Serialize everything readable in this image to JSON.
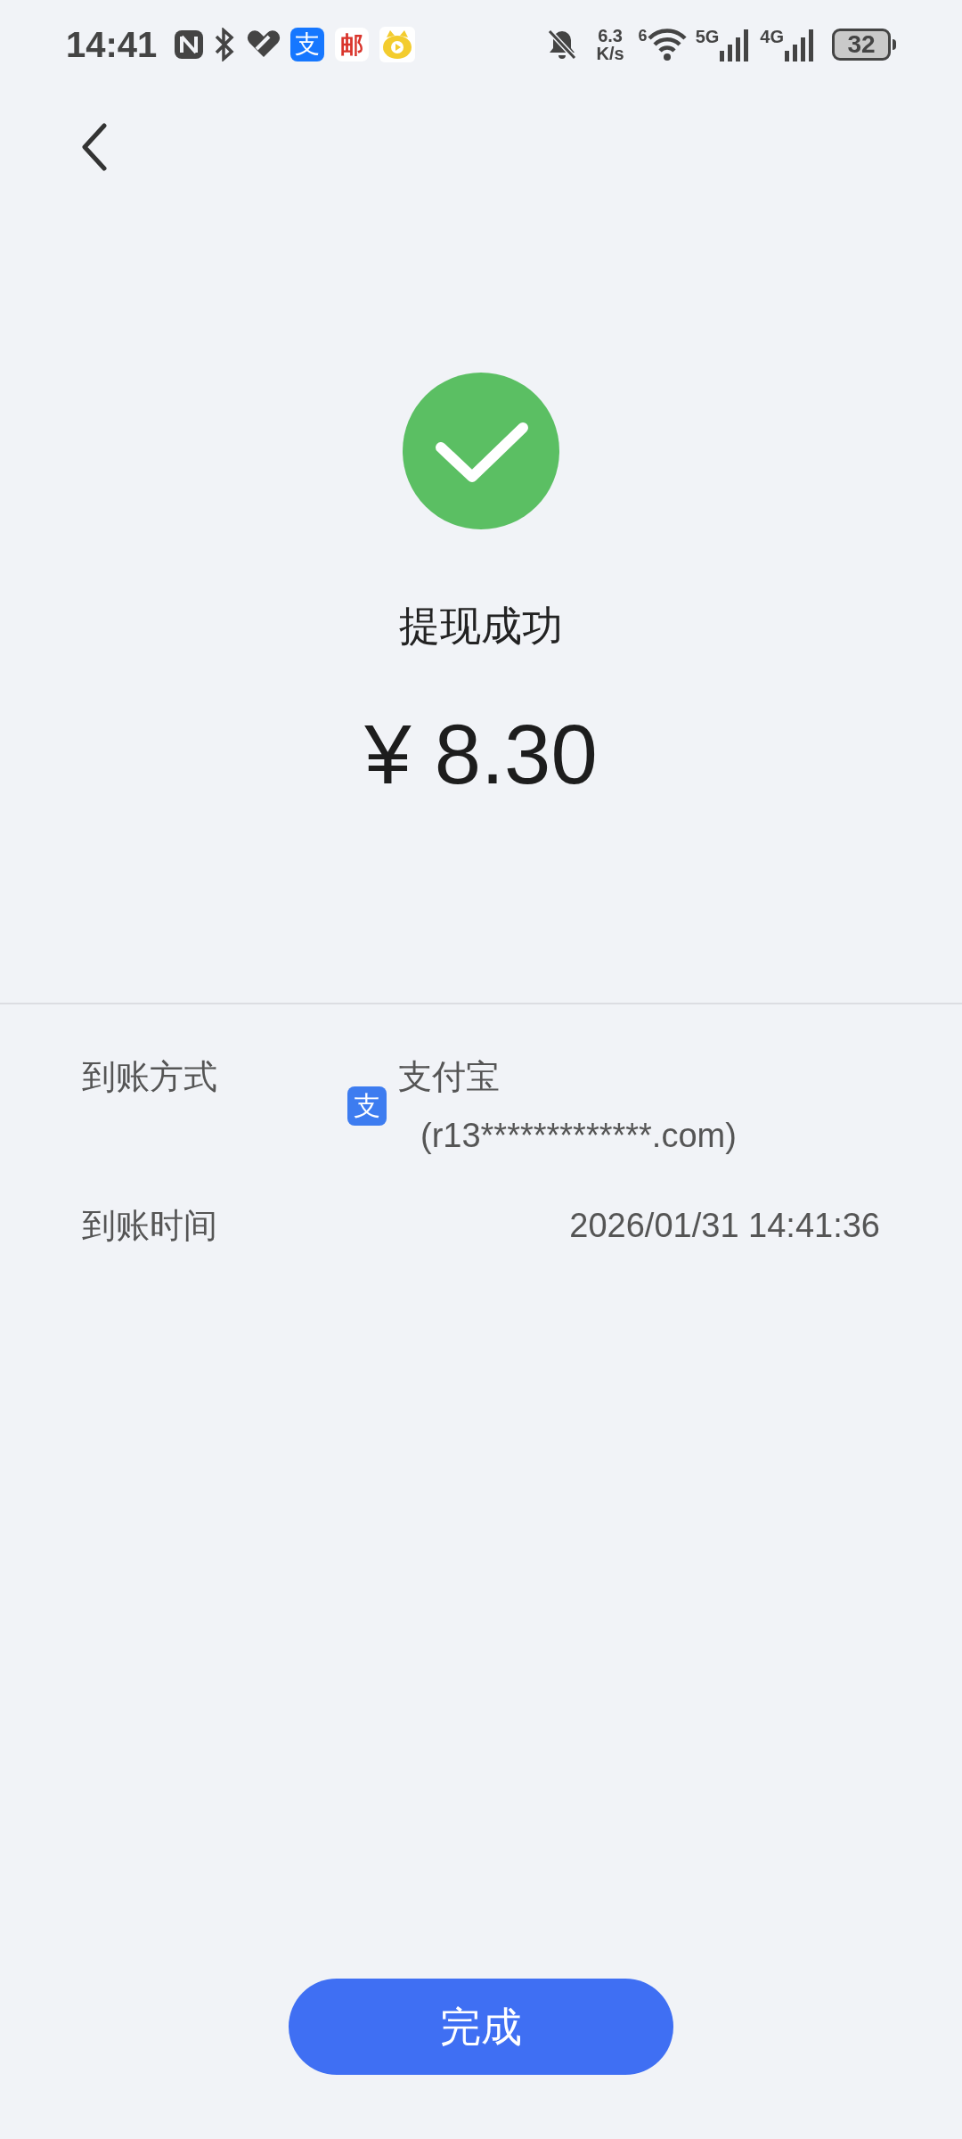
{
  "status_bar": {
    "time": "14:41",
    "app_icons": [
      {
        "glyph": "支",
        "kind": "alipay"
      },
      {
        "glyph": "邮",
        "kind": "mail"
      },
      {
        "kind": "video"
      }
    ],
    "speed_value": "6.3",
    "speed_unit": "K/s",
    "wifi_label": "6",
    "sim1_label": "5G",
    "sim2_label": "4G",
    "battery": "32"
  },
  "result": {
    "title": "提现成功",
    "amount": "¥ 8.30"
  },
  "details": [
    {
      "kind": "method",
      "label": "到账方式",
      "icon_glyph": "支",
      "value": "支付宝",
      "account": "(r13*************.com)"
    },
    {
      "kind": "time",
      "label": "到账时间",
      "value": "2026/01/31 14:41:36"
    }
  ],
  "button": "完成"
}
